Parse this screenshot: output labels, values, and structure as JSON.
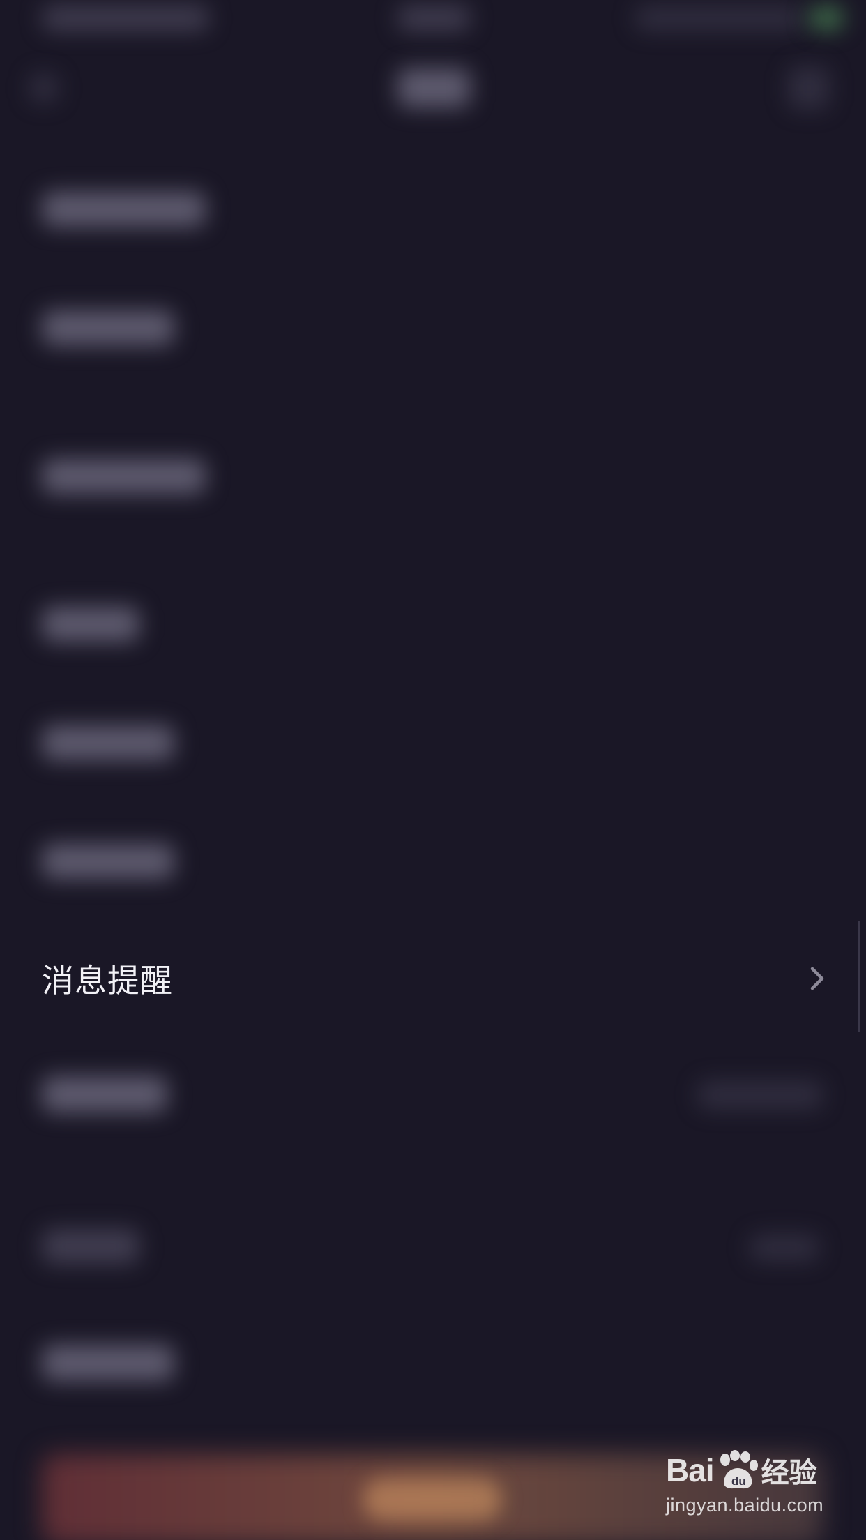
{
  "settings": {
    "highlighted_item": {
      "label": "消息提醒",
      "icon": "chevron-right-icon"
    }
  },
  "watermark": {
    "brand_prefix": "Bai",
    "brand_suffix": "经验",
    "icon": "paw-icon",
    "domain": "jingyan.baidu.com"
  },
  "colors": {
    "background": "#1a1726",
    "label": "#f2f1f6",
    "chevron": "#8d8a99"
  }
}
